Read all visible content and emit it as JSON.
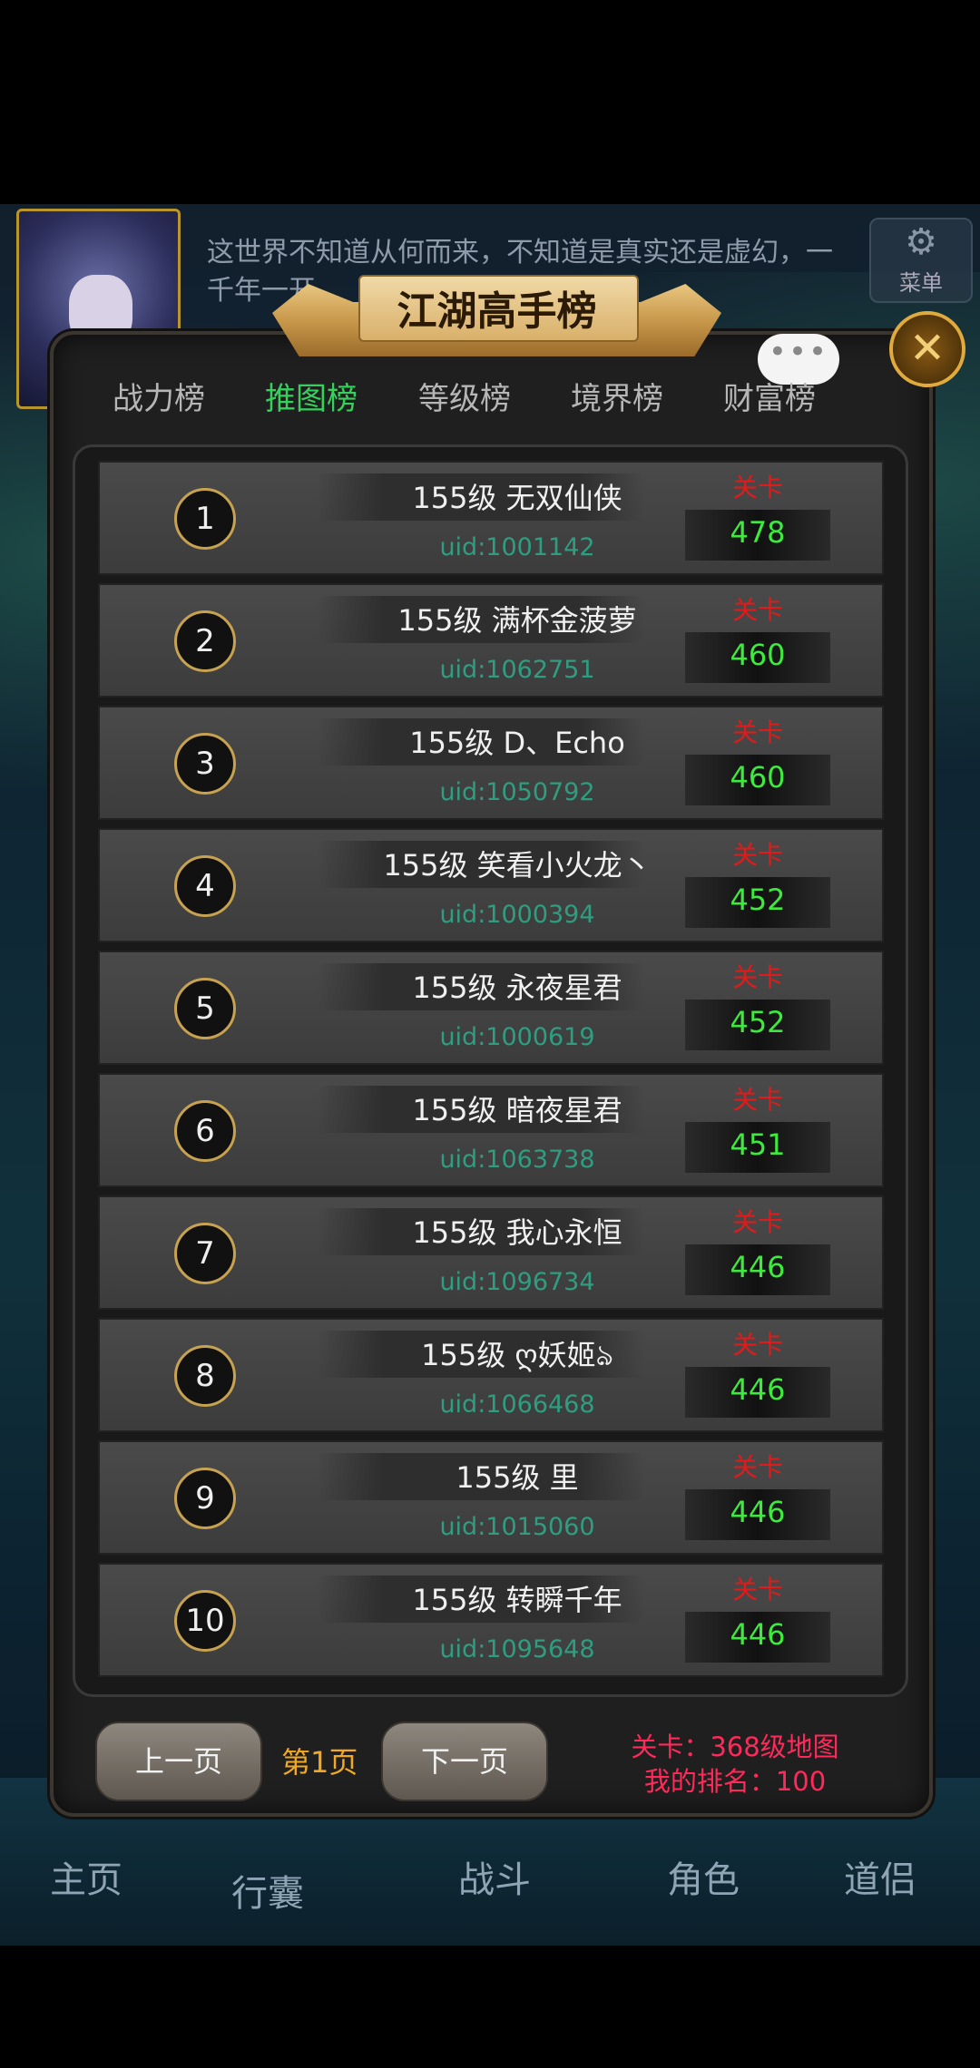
{
  "background": {
    "story_text": "这世界不知道从何而来，不知道是真实还是虚幻，一千年一开，",
    "menu_label": "菜单",
    "nav": [
      "主页",
      "行囊",
      "战斗",
      "角色",
      "道侣"
    ]
  },
  "panel": {
    "title": "江湖高手榜",
    "close_icon": "✕",
    "chat_icon": "•••",
    "tabs": [
      {
        "label": "战力榜",
        "active": false
      },
      {
        "label": "推图榜",
        "active": true
      },
      {
        "label": "等级榜",
        "active": false
      },
      {
        "label": "境界榜",
        "active": false
      },
      {
        "label": "财富榜",
        "active": false
      }
    ],
    "rows": [
      {
        "rank": "1",
        "name": "155级 无双仙侠",
        "uid": "uid:1001142",
        "stage_label": "关卡",
        "stage": "478"
      },
      {
        "rank": "2",
        "name": "155级 满杯金菠萝",
        "uid": "uid:1062751",
        "stage_label": "关卡",
        "stage": "460"
      },
      {
        "rank": "3",
        "name": "155级 D、Echo",
        "uid": "uid:1050792",
        "stage_label": "关卡",
        "stage": "460"
      },
      {
        "rank": "4",
        "name": "155级 笑看小火龙丶",
        "uid": "uid:1000394",
        "stage_label": "关卡",
        "stage": "452"
      },
      {
        "rank": "5",
        "name": "155级 永夜星君",
        "uid": "uid:1000619",
        "stage_label": "关卡",
        "stage": "452"
      },
      {
        "rank": "6",
        "name": "155级 暗夜星君",
        "uid": "uid:1063738",
        "stage_label": "关卡",
        "stage": "451"
      },
      {
        "rank": "7",
        "name": "155级 我心永恒",
        "uid": "uid:1096734",
        "stage_label": "关卡",
        "stage": "446"
      },
      {
        "rank": "8",
        "name": "155级 ღ妖姬ঌ",
        "uid": "uid:1066468",
        "stage_label": "关卡",
        "stage": "446"
      },
      {
        "rank": "9",
        "name": "155级 里",
        "uid": "uid:1015060",
        "stage_label": "关卡",
        "stage": "446"
      },
      {
        "rank": "10",
        "name": "155级 转瞬千年",
        "uid": "uid:1095648",
        "stage_label": "关卡",
        "stage": "446"
      }
    ],
    "prev_label": "上一页",
    "page_label": "第1页",
    "next_label": "下一页",
    "my_stage": "关卡：368级地图",
    "my_rank": "我的排名：100"
  },
  "colors": {
    "active_tab": "#35d15c",
    "uid": "#2f9e80",
    "stage_label": "#e01b1b",
    "stage_value": "#3eea3e",
    "page_label": "#f1a826",
    "my_info": "#ff2a5a"
  }
}
